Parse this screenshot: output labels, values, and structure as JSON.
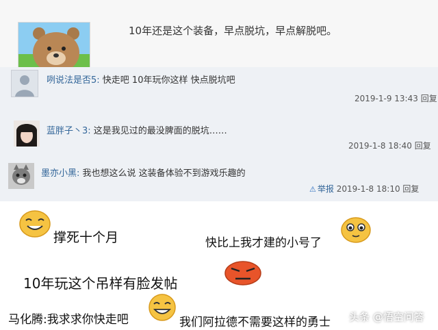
{
  "post": {
    "text": "10年还是这个装备，早点脱坑，早点解脱吧。"
  },
  "comments": [
    {
      "user": "咧说法是否5:",
      "text": "快走吧 10年玩你这样 快点脱坑吧",
      "time": "2019-1-9 13:43",
      "reply": "回复"
    },
    {
      "user": "蓝胖子丶3:",
      "text": "这是我见过的最没脾面的脱坑……",
      "time": "2019-1-8 18:40",
      "reply": "回复"
    },
    {
      "user": "墨亦小黑:",
      "text": "我也想这么说 这装备体验不到游戏乐趣的",
      "report": "举报",
      "time": "2019-1-8 18:10",
      "reply": "回复"
    }
  ],
  "memes": {
    "m1": "撑死十个月",
    "m2": "快比上我才建的小号了",
    "m3": "10年玩这个吊样有脸发帖",
    "m4": "马化腾:我求求你快走吧",
    "m5": "我们阿拉德不需要这样的勇士"
  },
  "watermark": "头条 @悟空问答",
  "colors": {
    "username": "#336699",
    "comments_bg": "#eef1f5",
    "emoji_yellow": "#f5c342",
    "emoji_red": "#e8542a"
  }
}
